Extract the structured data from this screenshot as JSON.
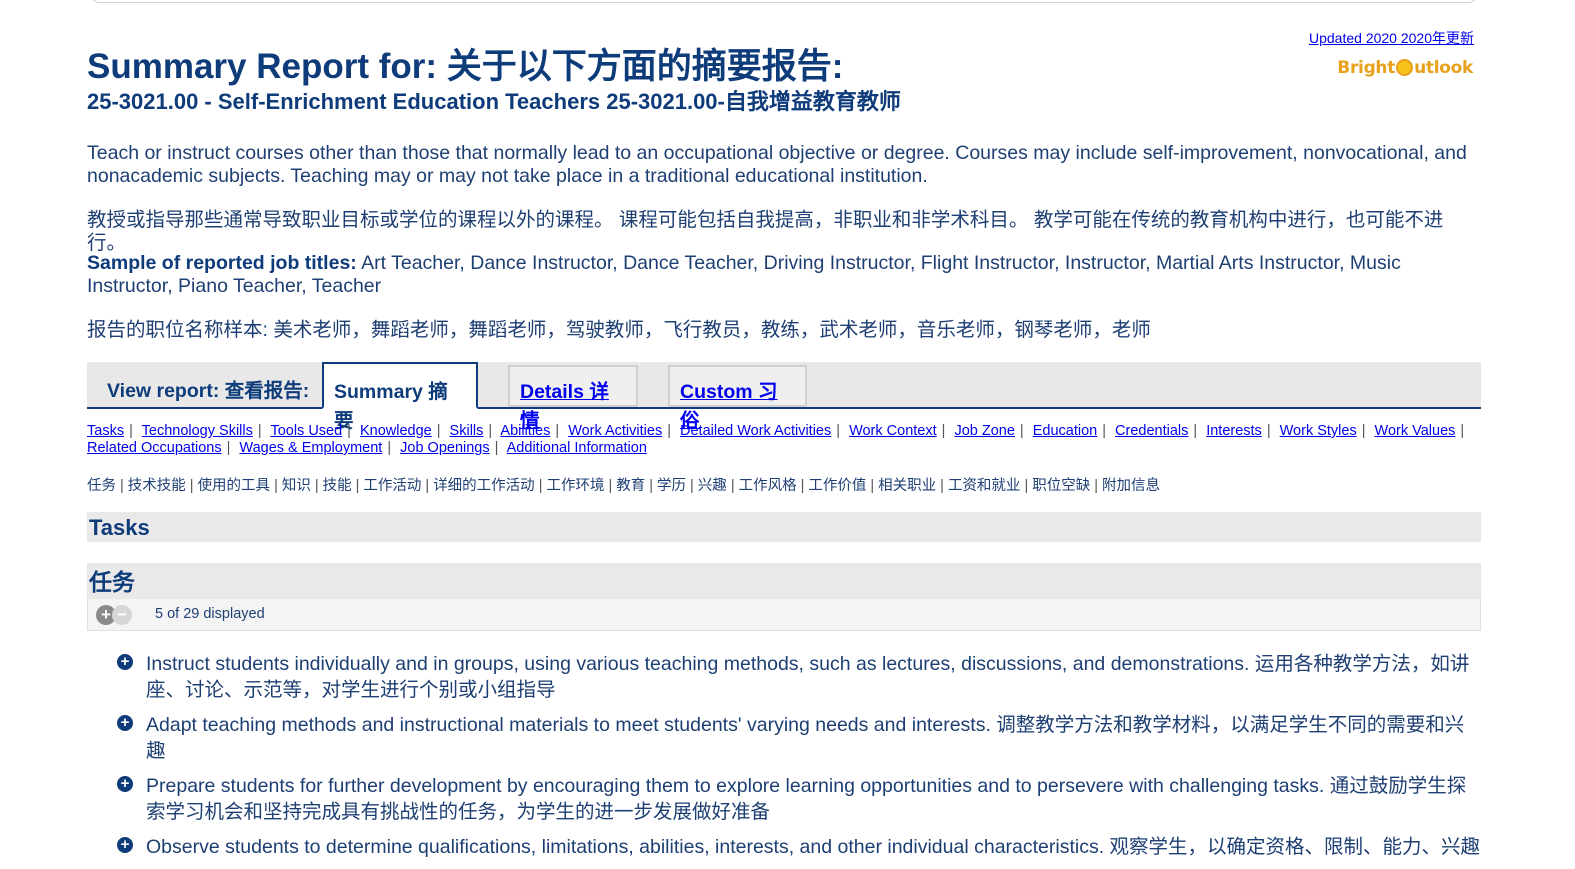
{
  "header": {
    "updated_link": "Updated 2020 2020年更新",
    "logo_text_a": "Bright",
    "logo_text_b": "utlook",
    "title": "Summary Report for: 关于以下方面的摘要报告:",
    "subtitle": "25-3021.00 - Self-Enrichment Education Teachers 25-3021.00-自我增益教育教师"
  },
  "description": {
    "en": "Teach or instruct courses other than those that normally lead to an occupational objective or degree. Courses may include self-improvement, nonvocational, and nonacademic subjects. Teaching may or may not take place in a traditional educational institution.",
    "zh": "教授或指导那些通常导致职业目标或学位的课程以外的课程。 课程可能包括自我提高，非职业和非学术科目。 教学可能在传统的教育机构中进行，也可能不进行。"
  },
  "job_titles": {
    "label": "Sample of reported job titles:",
    "en": " Art Teacher, Dance Instructor, Dance Teacher, Driving Instructor, Flight Instructor, Instructor, Martial Arts Instructor, Music Instructor, Piano Teacher, Teacher",
    "zh": "报告的职位名称样本: 美术老师，舞蹈老师，舞蹈老师，驾驶教师，飞行教员，教练，武术老师，音乐老师，钢琴老师，老师"
  },
  "view_report": {
    "label": "View report:  查看报告:",
    "tabs": [
      {
        "label": "Summary 摘要"
      },
      {
        "label": "Details 详情"
      },
      {
        "label": "Custom 习俗"
      }
    ]
  },
  "nav_links": [
    "Tasks",
    "Technology Skills",
    "Tools Used",
    "Knowledge",
    "Skills",
    "Abilities",
    "Work Activities",
    "Detailed Work Activities",
    "Work Context",
    "Job Zone",
    "Education",
    "Credentials",
    "Interests",
    "Work Styles",
    "Work Values",
    "Related Occupations",
    "Wages & Employment",
    "Job Openings",
    "Additional Information"
  ],
  "nav_links_zh": [
    "任务",
    "技术技能",
    "使用的工具",
    "知识",
    "技能",
    "工作活动",
    "详细的工作活动",
    "工作环境",
    "教育",
    "学历",
    "兴趣",
    "工作风格",
    "工作价值",
    "相关职业",
    "工资和就业",
    "职位空缺",
    "附加信息"
  ],
  "tasks_section": {
    "heading": "Tasks",
    "heading_zh": "任务",
    "count_text": "5 of 29 displayed",
    "items": [
      "Instruct students individually and in groups, using various teaching methods, such as lectures, discussions, and demonstrations. 运用各种教学方法，如讲座、讨论、示范等，对学生进行个别或小组指导",
      "Adapt teaching methods and instructional materials to meet students' varying needs and interests. 调整教学方法和教学材料，以满足学生不同的需要和兴趣",
      "Prepare students for further development by encouraging them to explore learning opportunities and to persevere with challenging tasks. 通过鼓励学生探索学习机会和坚持完成具有挑战性的任务，为学生的进一步发展做好准备",
      "Observe students to determine qualifications, limitations, abilities, interests, and other individual characteristics. 观察学生，以确定资格、限制、能力、兴趣"
    ]
  },
  "colors": {
    "heading_blue": "#0e3b7a",
    "link_blue": "#0000ee",
    "logo_orange": "#e8a11c",
    "section_gray": "#e9e9e9"
  }
}
